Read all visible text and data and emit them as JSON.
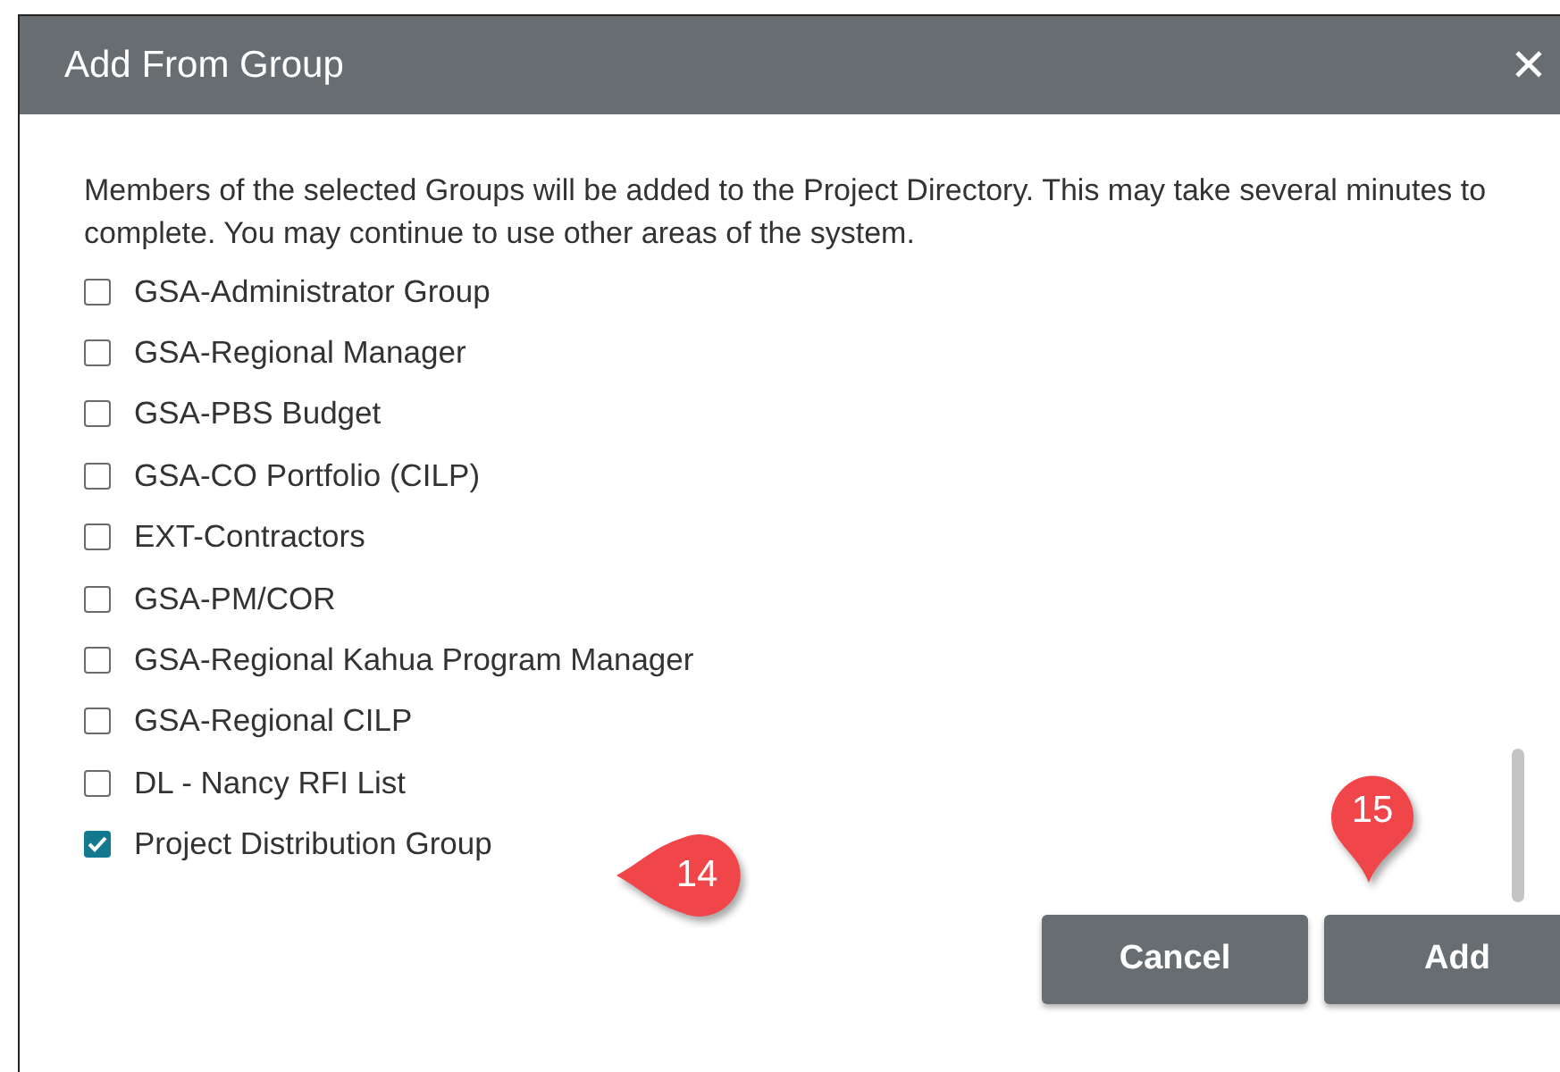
{
  "dialog": {
    "title": "Add From Group",
    "close_icon": "✕",
    "intro": "Members of the selected Groups will be added to the Project Directory.  This may take several minutes to complete.  You may continue to use other areas of the system.",
    "groups": [
      {
        "label": "GSA-Administrator Group",
        "checked": false
      },
      {
        "label": "GSA-Regional Manager",
        "checked": false
      },
      {
        "label": "GSA-PBS Budget",
        "checked": false
      },
      {
        "label": "GSA-CO Portfolio (CILP)",
        "checked": false
      },
      {
        "label": "EXT-Contractors",
        "checked": false
      },
      {
        "label": "GSA-PM/COR",
        "checked": false
      },
      {
        "label": "GSA-Regional Kahua Program Manager",
        "checked": false
      },
      {
        "label": "GSA-Regional CILP",
        "checked": false
      },
      {
        "label": "DL - Nancy RFI List",
        "checked": false
      },
      {
        "label": "Project Distribution Group",
        "checked": true
      }
    ],
    "buttons": [
      "Cancel",
      "Add"
    ]
  },
  "callouts": [
    {
      "number": "14",
      "kind": "left"
    },
    {
      "number": "15",
      "kind": "down"
    }
  ]
}
